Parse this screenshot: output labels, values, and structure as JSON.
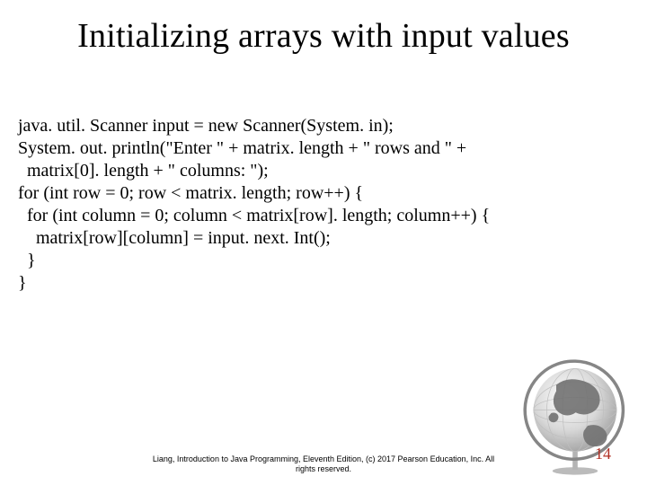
{
  "title": "Initializing arrays with input values",
  "code": {
    "l1": "java. util. Scanner input = new Scanner(System. in);",
    "l2": "System. out. println(\"Enter \" + matrix. length + \" rows and \" +",
    "l3": "  matrix[0]. length + \" columns: \");",
    "l4": "for (int row = 0; row < matrix. length; row++) {",
    "l5": "  for (int column = 0; column < matrix[row]. length; column++) {",
    "l6": "    matrix[row][column] = input. next. Int();",
    "l7": "  }",
    "l8": "}"
  },
  "footer": {
    "line1": "Liang, Introduction to Java Programming, Eleventh Edition, (c) 2017 Pearson Education, Inc. All",
    "line2": "rights reserved."
  },
  "page": "14"
}
